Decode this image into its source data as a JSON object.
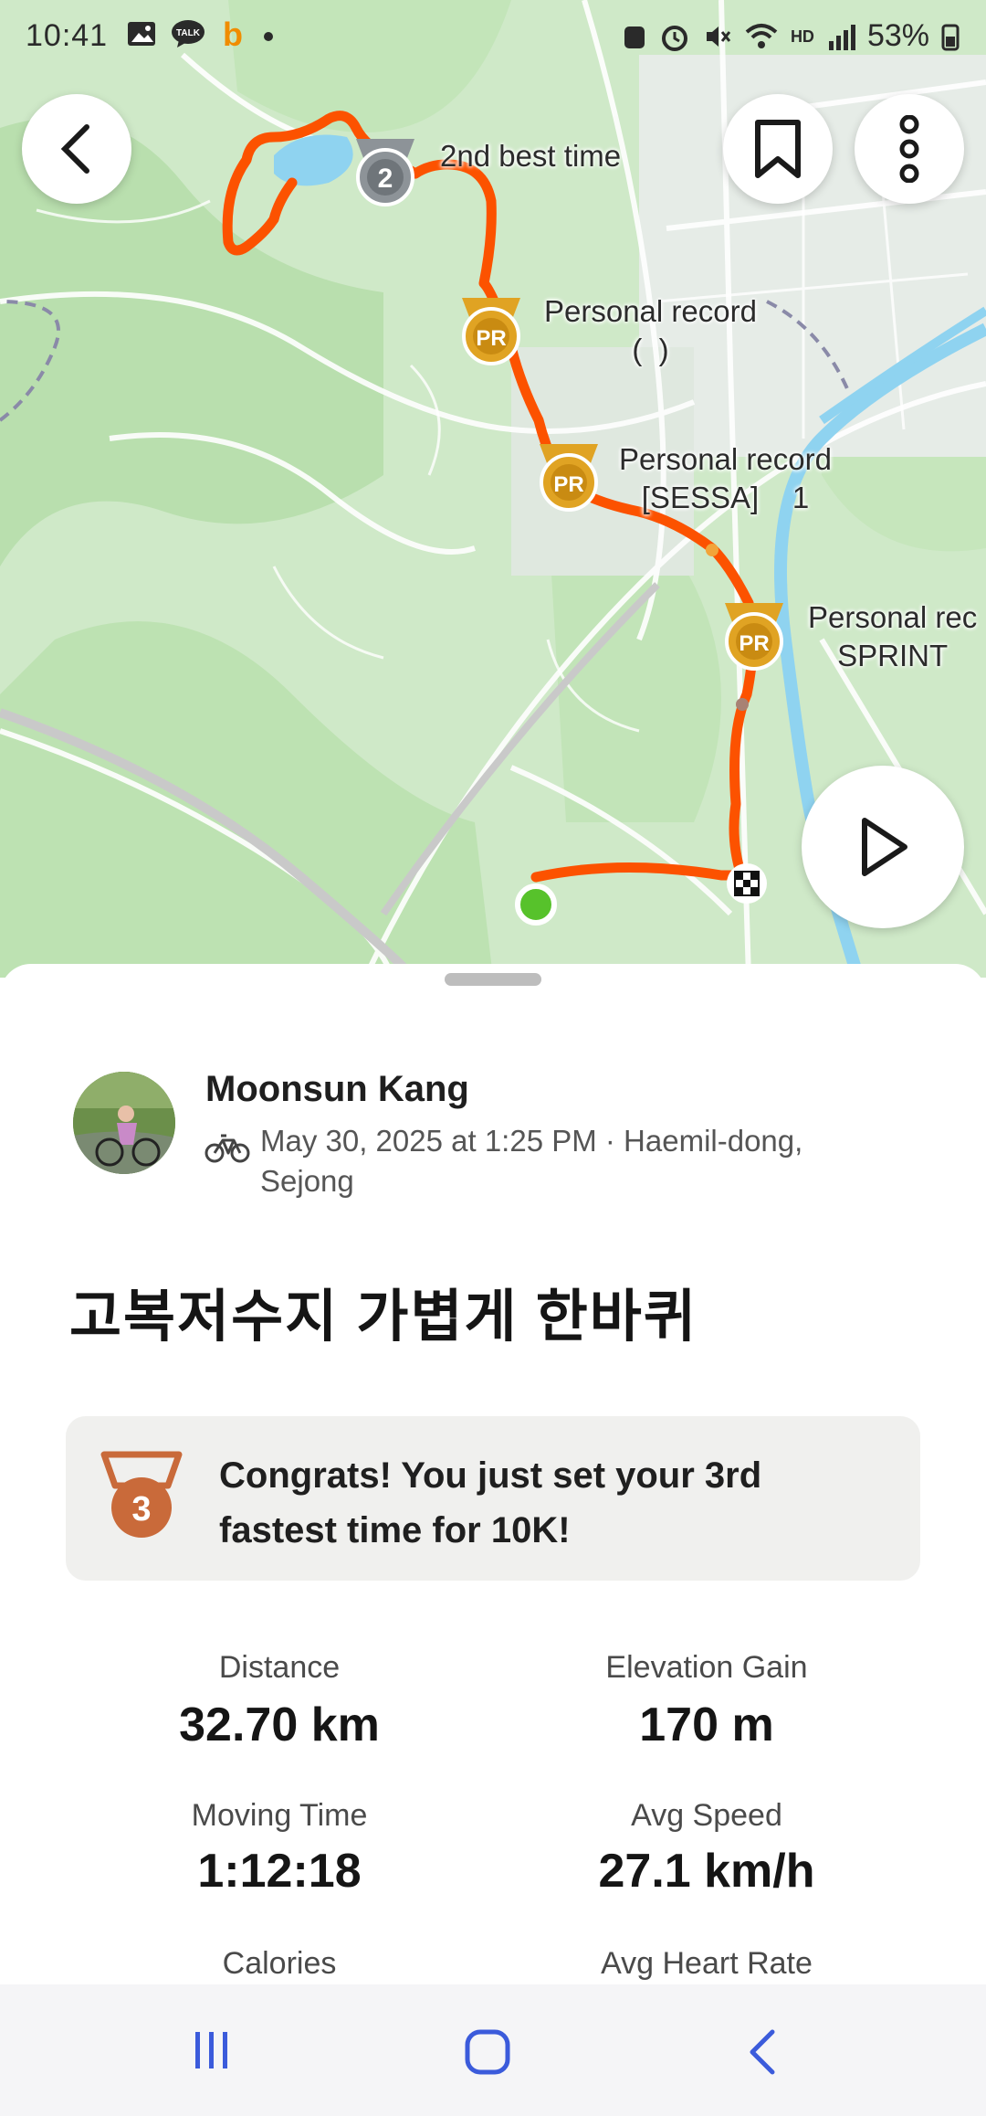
{
  "status_bar": {
    "time": "10:41",
    "battery": "53%",
    "network_label": "HD"
  },
  "map": {
    "segment_badges": [
      {
        "type": "silver-2",
        "label": "2nd best time"
      },
      {
        "type": "pr",
        "label": "Personal record\n(  )"
      },
      {
        "type": "pr",
        "label": "Personal record\n[SESSA]    1"
      },
      {
        "type": "pr",
        "label": "Personal rec\nSPRINT"
      }
    ],
    "colors": {
      "route": "#fc5200",
      "start": "#57c22b",
      "land": "#cfe9c8",
      "water": "#8fd3f0"
    }
  },
  "activity": {
    "athlete_name": "Moonsun Kang",
    "meta": "May 30, 2025 at 1:25 PM · Haemil-dong, Sejong",
    "sport_icon": "bike-icon",
    "title": "고복저수지 가볍게 한바퀴",
    "achievement": {
      "medal_rank": "3",
      "text": "Congrats! You just set your 3rd fastest time for 10K!"
    },
    "stats": [
      {
        "label": "Distance",
        "value": "32.70 km"
      },
      {
        "label": "Elevation Gain",
        "value": "170 m"
      },
      {
        "label": "Moving Time",
        "value": "1:12:18"
      },
      {
        "label": "Avg Speed",
        "value": "27.1 km/h"
      },
      {
        "label": "Calories",
        "value": ""
      },
      {
        "label": "Avg Heart Rate",
        "value": ""
      }
    ]
  }
}
